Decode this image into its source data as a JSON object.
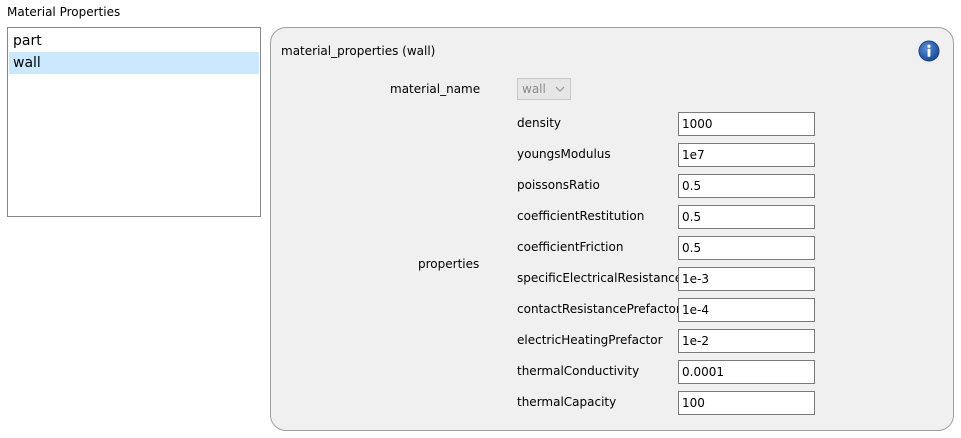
{
  "page": {
    "title": "Material Properties"
  },
  "materials": {
    "items": [
      {
        "label": "part",
        "selected": false
      },
      {
        "label": "wall",
        "selected": true
      }
    ]
  },
  "panel": {
    "title": "material_properties (wall)",
    "info_icon": "info-icon",
    "material_name_label": "material_name",
    "material_name_value": "wall",
    "properties_label": "properties",
    "properties": [
      {
        "label": "density",
        "value": "1000"
      },
      {
        "label": "youngsModulus",
        "value": "1e7"
      },
      {
        "label": "poissonsRatio",
        "value": "0.5"
      },
      {
        "label": "coefficientRestitution",
        "value": "0.5"
      },
      {
        "label": "coefficientFriction",
        "value": "0.5"
      },
      {
        "label": "specificElectricalResistance",
        "value": "1e-3"
      },
      {
        "label": "contactResistancePrefactor",
        "value": "1e-4"
      },
      {
        "label": "electricHeatingPrefactor",
        "value": "1e-2"
      },
      {
        "label": "thermalConductivity",
        "value": "0.0001"
      },
      {
        "label": "thermalCapacity",
        "value": "100"
      }
    ]
  },
  "colors": {
    "selection": "#cce8ff",
    "panel_background": "#f0f0f0",
    "info_icon": "#1e5aa8"
  }
}
